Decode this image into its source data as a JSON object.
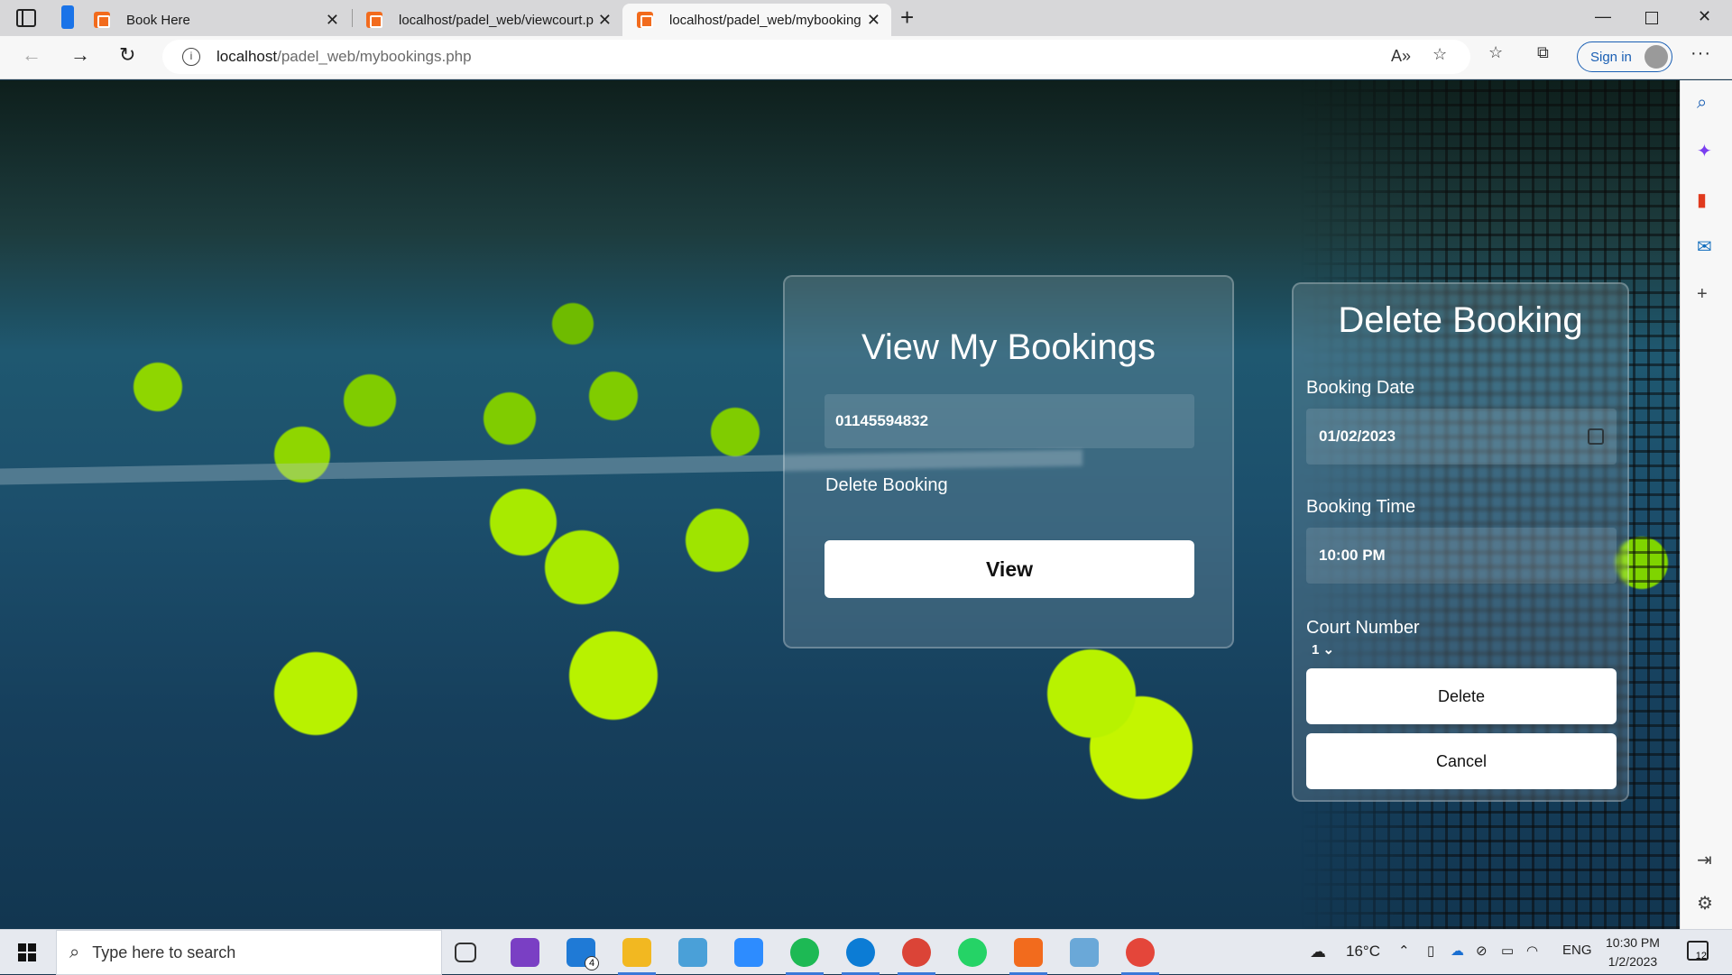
{
  "browser": {
    "tabs": [
      {
        "title": "Book Here"
      },
      {
        "title": "localhost/padel_web/viewcourt.p"
      },
      {
        "title": "localhost/padel_web/mybooking"
      }
    ],
    "url_host": "localhost",
    "url_path": "/padel_web/mybookings.php",
    "sign_in": "Sign in"
  },
  "view_card": {
    "title": "View My Bookings",
    "phone_value": "01145594832",
    "delete_link": "Delete Booking",
    "view_button": "View"
  },
  "delete_card": {
    "title": "Delete Booking",
    "date_label": "Booking Date",
    "date_value": "01/02/2023",
    "time_label": "Booking Time",
    "time_value": "10:00 PM",
    "court_label": "Court Number",
    "court_value": "1",
    "delete_button": "Delete",
    "cancel_button": "Cancel"
  },
  "taskbar": {
    "search_placeholder": "Type here to search",
    "weather": "16°C",
    "lang": "ENG",
    "time": "10:30 PM",
    "date": "1/2/2023",
    "mail_badge": "4",
    "notif_count": "12"
  },
  "colors": {
    "accent": "#1a5fb4",
    "tennis_ball": "#b8f200",
    "court": "#1c4f6c"
  }
}
